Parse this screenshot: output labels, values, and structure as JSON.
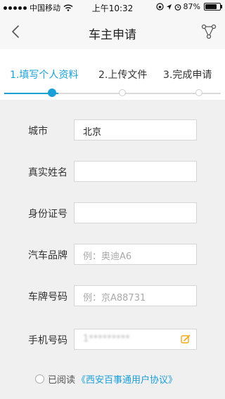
{
  "status_bar": {
    "carrier": "中国移动",
    "time": "上午10:32",
    "battery": "87%",
    "battery_level": 0.87
  },
  "nav": {
    "title": "车主申请"
  },
  "steps": {
    "items": [
      {
        "label": "1.填写个人资料",
        "active": true
      },
      {
        "label": "2.上传文件",
        "active": false
      },
      {
        "label": "3.完成申请",
        "active": false
      }
    ],
    "progress": 0.25
  },
  "form": {
    "fields": [
      {
        "label": "城市",
        "value": "北京",
        "placeholder": ""
      },
      {
        "label": "真实姓名",
        "value": "",
        "placeholder": ""
      },
      {
        "label": "身份证号",
        "value": "",
        "placeholder": ""
      },
      {
        "label": "汽车品牌",
        "value": "",
        "placeholder": "例：奥迪A6"
      },
      {
        "label": "车牌号码",
        "value": "",
        "placeholder": "例：京A88731"
      },
      {
        "label": "手机号码",
        "value": "1*********",
        "placeholder": ""
      }
    ]
  },
  "agreement": {
    "text": "已阅读",
    "link": "《西安百事通用户协议》"
  },
  "colors": {
    "accent": "#1a9fd9",
    "edit_icon": "#f0a820"
  }
}
